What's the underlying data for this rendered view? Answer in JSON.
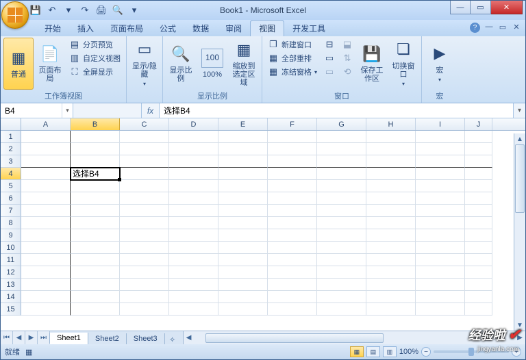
{
  "window": {
    "title": "Book1 - Microsoft Excel",
    "minimize": "—",
    "maximize": "▭",
    "close": "✕"
  },
  "qat": {
    "save": "💾",
    "undo": "↶",
    "redo": "↷",
    "print": "🖨",
    "preview": "🔍"
  },
  "tabs": [
    "开始",
    "插入",
    "页面布局",
    "公式",
    "数据",
    "审阅",
    "视图",
    "开发工具"
  ],
  "active_tab": "视图",
  "ribbon": {
    "views_group": {
      "label": "工作簿视图",
      "normal": "普通",
      "page_layout": "页面布局",
      "page_break": "分页预览",
      "custom_views": "自定义视图",
      "full_screen": "全屏显示"
    },
    "showhide_group": {
      "label": "",
      "show_hide": "显示/隐藏"
    },
    "zoom_group": {
      "label": "显示比例",
      "zoom": "显示比例",
      "hundred": "100%",
      "to_selection": "缩放到选定区域"
    },
    "window_group": {
      "label": "窗口",
      "new_window": "新建窗口",
      "arrange_all": "全部重排",
      "freeze": "冻结窗格",
      "split": "▭",
      "hide": "▭",
      "switch": "切换窗口",
      "save_ws": "保存工作区"
    },
    "macros_group": {
      "label": "宏",
      "macros": "宏"
    }
  },
  "name_box": "B4",
  "formula": "选择B4",
  "columns": [
    "A",
    "B",
    "C",
    "D",
    "E",
    "F",
    "G",
    "H",
    "I",
    "J"
  ],
  "rows": [
    "1",
    "2",
    "3",
    "4",
    "5",
    "6",
    "7",
    "8",
    "9",
    "10",
    "11",
    "12",
    "13",
    "14",
    "15"
  ],
  "active_cell": {
    "row": 4,
    "col": "B",
    "value": "选择B4"
  },
  "sheets": [
    "Sheet1",
    "Sheet2",
    "Sheet3"
  ],
  "active_sheet": "Sheet1",
  "status": {
    "ready": "就绪",
    "macro": "▦",
    "zoom": "100%",
    "minus": "−",
    "plus": "+"
  },
  "watermark": {
    "main": "经验啦",
    "sub": "jingyanla.com"
  }
}
